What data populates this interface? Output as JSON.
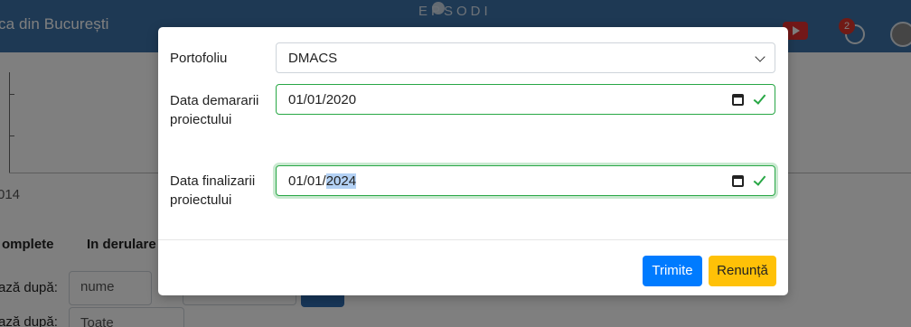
{
  "background": {
    "topbar_title": "ca din București",
    "brand_text": "EPSODI",
    "notification_count": "2",
    "chart_year_label": "014",
    "tabs": [
      "omplete",
      "In derulare"
    ],
    "filter1_label": "ază după:",
    "filter1_value": "nume",
    "filter2_label": "ază după:",
    "filter2_value": "Toate"
  },
  "modal": {
    "portfolio_label": "Portofoliu",
    "portfolio_value": "DMACS",
    "start_label": "Data demararii proiectului",
    "start_value": "01/01/2020",
    "end_label": "Data finalizarii proiectului",
    "end_value_prefix": "01/01/",
    "end_value_selected": "2024",
    "submit_label": "Trimite",
    "cancel_label": "Renunță"
  },
  "colors": {
    "topbar": "#3c73a8",
    "primary": "#007bff",
    "warning": "#ffc107",
    "valid": "#28a745"
  },
  "icons": [
    "youtube-icon",
    "notifications-icon",
    "avatar",
    "chevron-down-icon",
    "calendar-icon",
    "check-icon"
  ]
}
